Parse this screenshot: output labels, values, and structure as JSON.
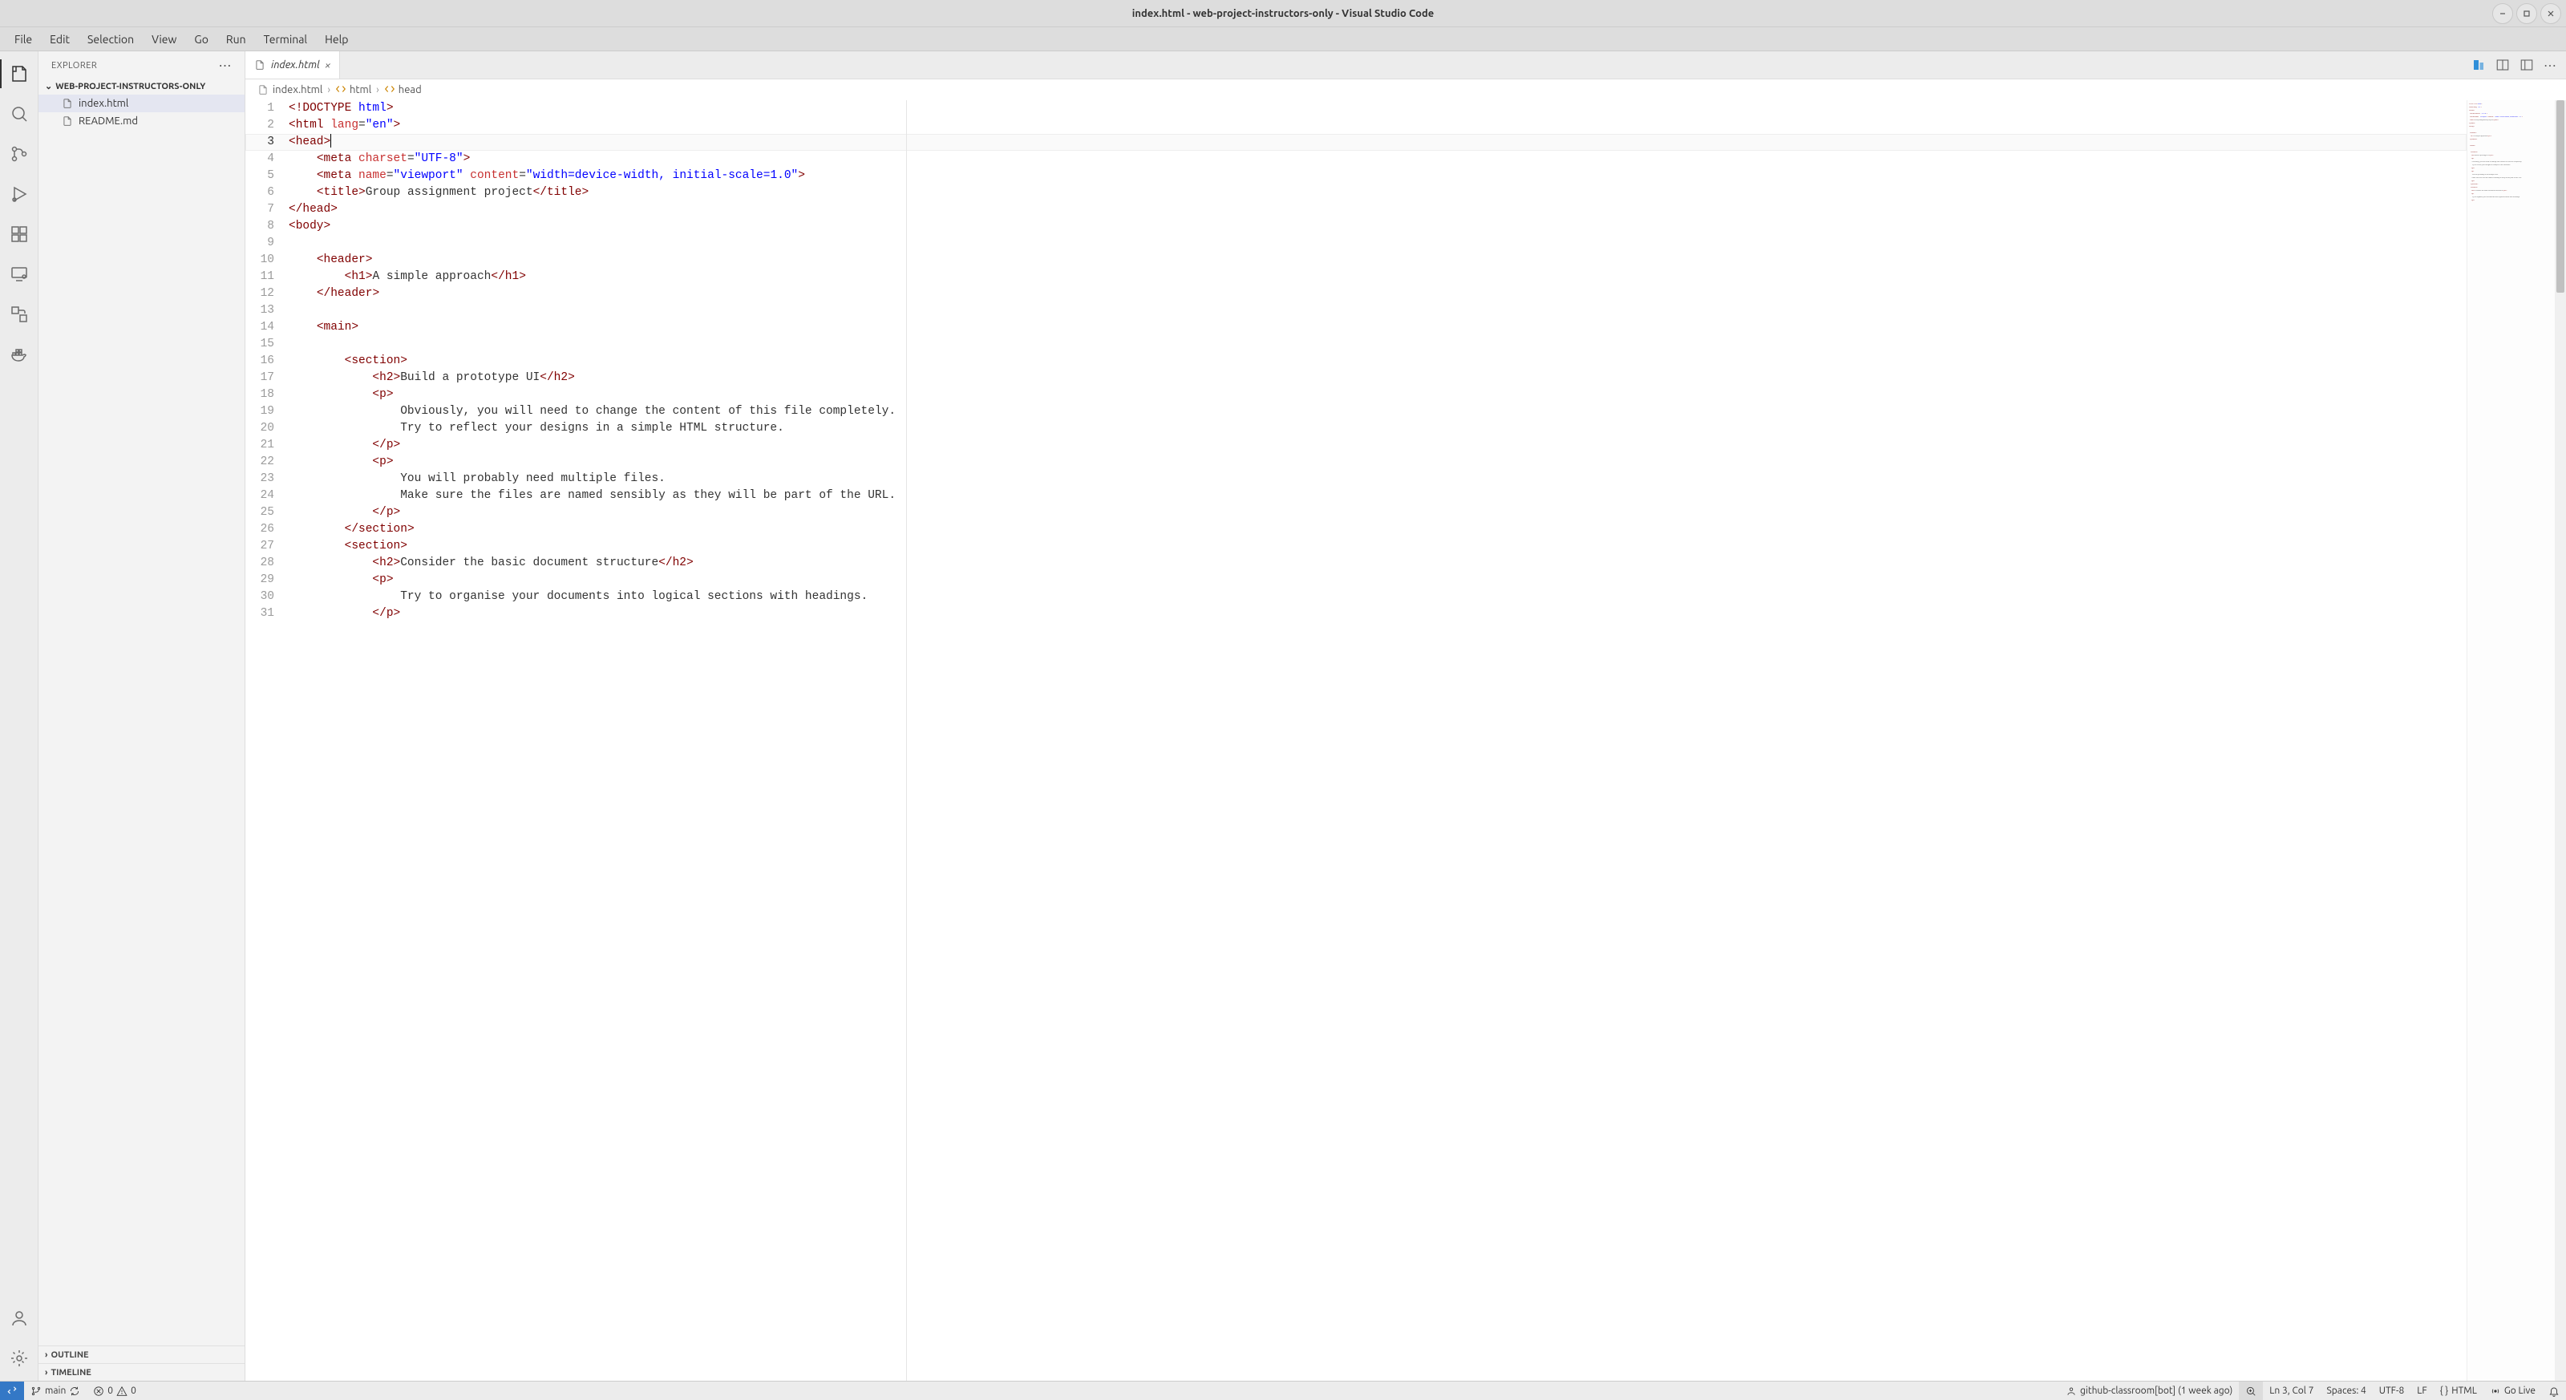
{
  "titlebar": {
    "title": "index.html - web-project-instructors-only - Visual Studio Code"
  },
  "menubar": [
    "File",
    "Edit",
    "Selection",
    "View",
    "Go",
    "Run",
    "Terminal",
    "Help"
  ],
  "sidebar": {
    "title": "EXPLORER",
    "folder": "WEB-PROJECT-INSTRUCTORS-ONLY",
    "files": [
      {
        "name": "index.html",
        "selected": true
      },
      {
        "name": "README.md",
        "selected": false
      }
    ],
    "sections": [
      "OUTLINE",
      "TIMELINE"
    ]
  },
  "tab": {
    "label": "index.html"
  },
  "breadcrumbs": [
    {
      "icon": "file",
      "label": "index.html"
    },
    {
      "icon": "symbol",
      "label": "html"
    },
    {
      "icon": "symbol",
      "label": "head"
    }
  ],
  "code": [
    {
      "n": 1,
      "tokens": [
        [
          "brkt",
          "<!"
        ],
        [
          "doctype",
          "DOCTYPE "
        ],
        [
          "doctype-kw",
          "html"
        ],
        [
          "brkt",
          ">"
        ]
      ]
    },
    {
      "n": 2,
      "tokens": [
        [
          "brkt",
          "<"
        ],
        [
          "tag",
          "html "
        ],
        [
          "attr",
          "lang"
        ],
        [
          "punc",
          "="
        ],
        [
          "val",
          "\"en\""
        ],
        [
          "brkt",
          ">"
        ]
      ]
    },
    {
      "n": 3,
      "current": true,
      "tokens": [
        [
          "brkt",
          "<"
        ],
        [
          "tag",
          "head"
        ],
        [
          "brkt",
          ">"
        ],
        [
          "cursor",
          ""
        ]
      ]
    },
    {
      "n": 4,
      "indent": 1,
      "tokens": [
        [
          "brkt",
          "<"
        ],
        [
          "tag",
          "meta "
        ],
        [
          "attr",
          "charset"
        ],
        [
          "punc",
          "="
        ],
        [
          "val",
          "\"UTF-8\""
        ],
        [
          "brkt",
          ">"
        ]
      ]
    },
    {
      "n": 5,
      "indent": 1,
      "tokens": [
        [
          "brkt",
          "<"
        ],
        [
          "tag",
          "meta "
        ],
        [
          "attr",
          "name"
        ],
        [
          "punc",
          "="
        ],
        [
          "val",
          "\"viewport\" "
        ],
        [
          "attr",
          "content"
        ],
        [
          "punc",
          "="
        ],
        [
          "val",
          "\"width=device-width, initial-scale=1.0\""
        ],
        [
          "brkt",
          ">"
        ]
      ]
    },
    {
      "n": 6,
      "indent": 1,
      "tokens": [
        [
          "brkt",
          "<"
        ],
        [
          "tag",
          "title"
        ],
        [
          "brkt",
          ">"
        ],
        [
          "text",
          "Group assignment project"
        ],
        [
          "brkt",
          "</"
        ],
        [
          "tag",
          "title"
        ],
        [
          "brkt",
          ">"
        ]
      ]
    },
    {
      "n": 7,
      "tokens": [
        [
          "brkt",
          "</"
        ],
        [
          "tag",
          "head"
        ],
        [
          "brkt",
          ">"
        ]
      ]
    },
    {
      "n": 8,
      "tokens": [
        [
          "brkt",
          "<"
        ],
        [
          "tag",
          "body"
        ],
        [
          "brkt",
          ">"
        ]
      ]
    },
    {
      "n": 9,
      "tokens": []
    },
    {
      "n": 10,
      "indent": 1,
      "tokens": [
        [
          "brkt",
          "<"
        ],
        [
          "tag",
          "header"
        ],
        [
          "brkt",
          ">"
        ]
      ]
    },
    {
      "n": 11,
      "indent": 2,
      "tokens": [
        [
          "brkt",
          "<"
        ],
        [
          "tag",
          "h1"
        ],
        [
          "brkt",
          ">"
        ],
        [
          "text",
          "A simple approach"
        ],
        [
          "brkt",
          "</"
        ],
        [
          "tag",
          "h1"
        ],
        [
          "brkt",
          ">"
        ]
      ]
    },
    {
      "n": 12,
      "indent": 1,
      "tokens": [
        [
          "brkt",
          "</"
        ],
        [
          "tag",
          "header"
        ],
        [
          "brkt",
          ">"
        ]
      ]
    },
    {
      "n": 13,
      "tokens": []
    },
    {
      "n": 14,
      "indent": 1,
      "tokens": [
        [
          "brkt",
          "<"
        ],
        [
          "tag",
          "main"
        ],
        [
          "brkt",
          ">"
        ]
      ]
    },
    {
      "n": 15,
      "tokens": []
    },
    {
      "n": 16,
      "indent": 2,
      "tokens": [
        [
          "brkt",
          "<"
        ],
        [
          "tag",
          "section"
        ],
        [
          "brkt",
          ">"
        ]
      ]
    },
    {
      "n": 17,
      "indent": 3,
      "tokens": [
        [
          "brkt",
          "<"
        ],
        [
          "tag",
          "h2"
        ],
        [
          "brkt",
          ">"
        ],
        [
          "text",
          "Build a prototype UI"
        ],
        [
          "brkt",
          "</"
        ],
        [
          "tag",
          "h2"
        ],
        [
          "brkt",
          ">"
        ]
      ]
    },
    {
      "n": 18,
      "indent": 3,
      "tokens": [
        [
          "brkt",
          "<"
        ],
        [
          "tag",
          "p"
        ],
        [
          "brkt",
          ">"
        ]
      ]
    },
    {
      "n": 19,
      "indent": 4,
      "tokens": [
        [
          "text",
          "Obviously, you will need to change the content of this file completely."
        ]
      ]
    },
    {
      "n": 20,
      "indent": 4,
      "tokens": [
        [
          "text",
          "Try to reflect your designs in a simple HTML structure."
        ]
      ]
    },
    {
      "n": 21,
      "indent": 3,
      "tokens": [
        [
          "brkt",
          "</"
        ],
        [
          "tag",
          "p"
        ],
        [
          "brkt",
          ">"
        ]
      ]
    },
    {
      "n": 22,
      "indent": 3,
      "tokens": [
        [
          "brkt",
          "<"
        ],
        [
          "tag",
          "p"
        ],
        [
          "brkt",
          ">"
        ]
      ]
    },
    {
      "n": 23,
      "indent": 4,
      "tokens": [
        [
          "text",
          "You will probably need multiple files."
        ]
      ]
    },
    {
      "n": 24,
      "indent": 4,
      "tokens": [
        [
          "text",
          "Make sure the files are named sensibly as they will be part of the URL."
        ]
      ]
    },
    {
      "n": 25,
      "indent": 3,
      "tokens": [
        [
          "brkt",
          "</"
        ],
        [
          "tag",
          "p"
        ],
        [
          "brkt",
          ">"
        ]
      ]
    },
    {
      "n": 26,
      "indent": 2,
      "tokens": [
        [
          "brkt",
          "</"
        ],
        [
          "tag",
          "section"
        ],
        [
          "brkt",
          ">"
        ]
      ]
    },
    {
      "n": 27,
      "indent": 2,
      "tokens": [
        [
          "brkt",
          "<"
        ],
        [
          "tag",
          "section"
        ],
        [
          "brkt",
          ">"
        ]
      ]
    },
    {
      "n": 28,
      "indent": 3,
      "tokens": [
        [
          "brkt",
          "<"
        ],
        [
          "tag",
          "h2"
        ],
        [
          "brkt",
          ">"
        ],
        [
          "text",
          "Consider the basic document structure"
        ],
        [
          "brkt",
          "</"
        ],
        [
          "tag",
          "h2"
        ],
        [
          "brkt",
          ">"
        ]
      ]
    },
    {
      "n": 29,
      "indent": 3,
      "tokens": [
        [
          "brkt",
          "<"
        ],
        [
          "tag",
          "p"
        ],
        [
          "brkt",
          ">"
        ]
      ]
    },
    {
      "n": 30,
      "indent": 4,
      "tokens": [
        [
          "text",
          "Try to organise your documents into logical sections with headings."
        ]
      ]
    },
    {
      "n": 31,
      "indent": 3,
      "tokens": [
        [
          "brkt",
          "</"
        ],
        [
          "tag",
          "p"
        ],
        [
          "brkt",
          ">"
        ]
      ]
    }
  ],
  "statusbar": {
    "branch": "main",
    "errors": "0",
    "warnings": "0",
    "blame": "github-classroom[bot] (1 week ago)",
    "lncol": "Ln 3, Col 7",
    "spaces": "Spaces: 4",
    "encoding": "UTF-8",
    "eol": "LF",
    "language": "HTML",
    "golive": "Go Live"
  }
}
